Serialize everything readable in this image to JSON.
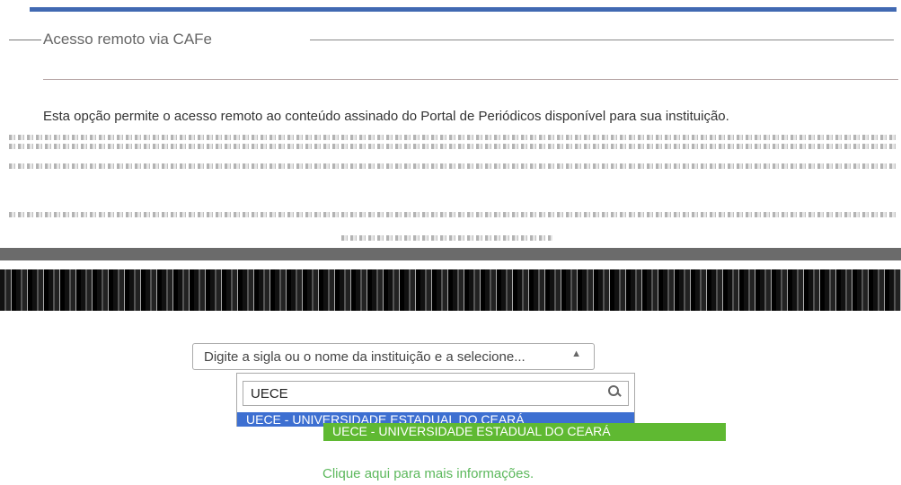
{
  "header": {
    "title": "Acesso remoto via CAFe"
  },
  "content": {
    "paragraph": "Esta opção permite o acesso remoto ao conteúdo assinado do Portal de Periódicos disponível para sua instituição.",
    "note": "Identificação por meio do CAFe com serviço de autenticação em parceria com a Rede Nacional de Ensino e Pesquisa (RNP)."
  },
  "institution_select": {
    "placeholder": "Digite a sigla ou o nome da instituição e a selecione..."
  },
  "search": {
    "value": "UECE",
    "option": "UECE - UNIVERSIDADE ESTADUAL DO CEARÁ"
  },
  "green_option": "UECE - UNIVERSIDADE ESTADUAL DO CEARÁ",
  "footer": {
    "info_link": "Clique aqui para mais informações."
  },
  "colors": {
    "accent": "#4169b2",
    "selection": "#3d6fd1",
    "success": "#5fb932"
  }
}
